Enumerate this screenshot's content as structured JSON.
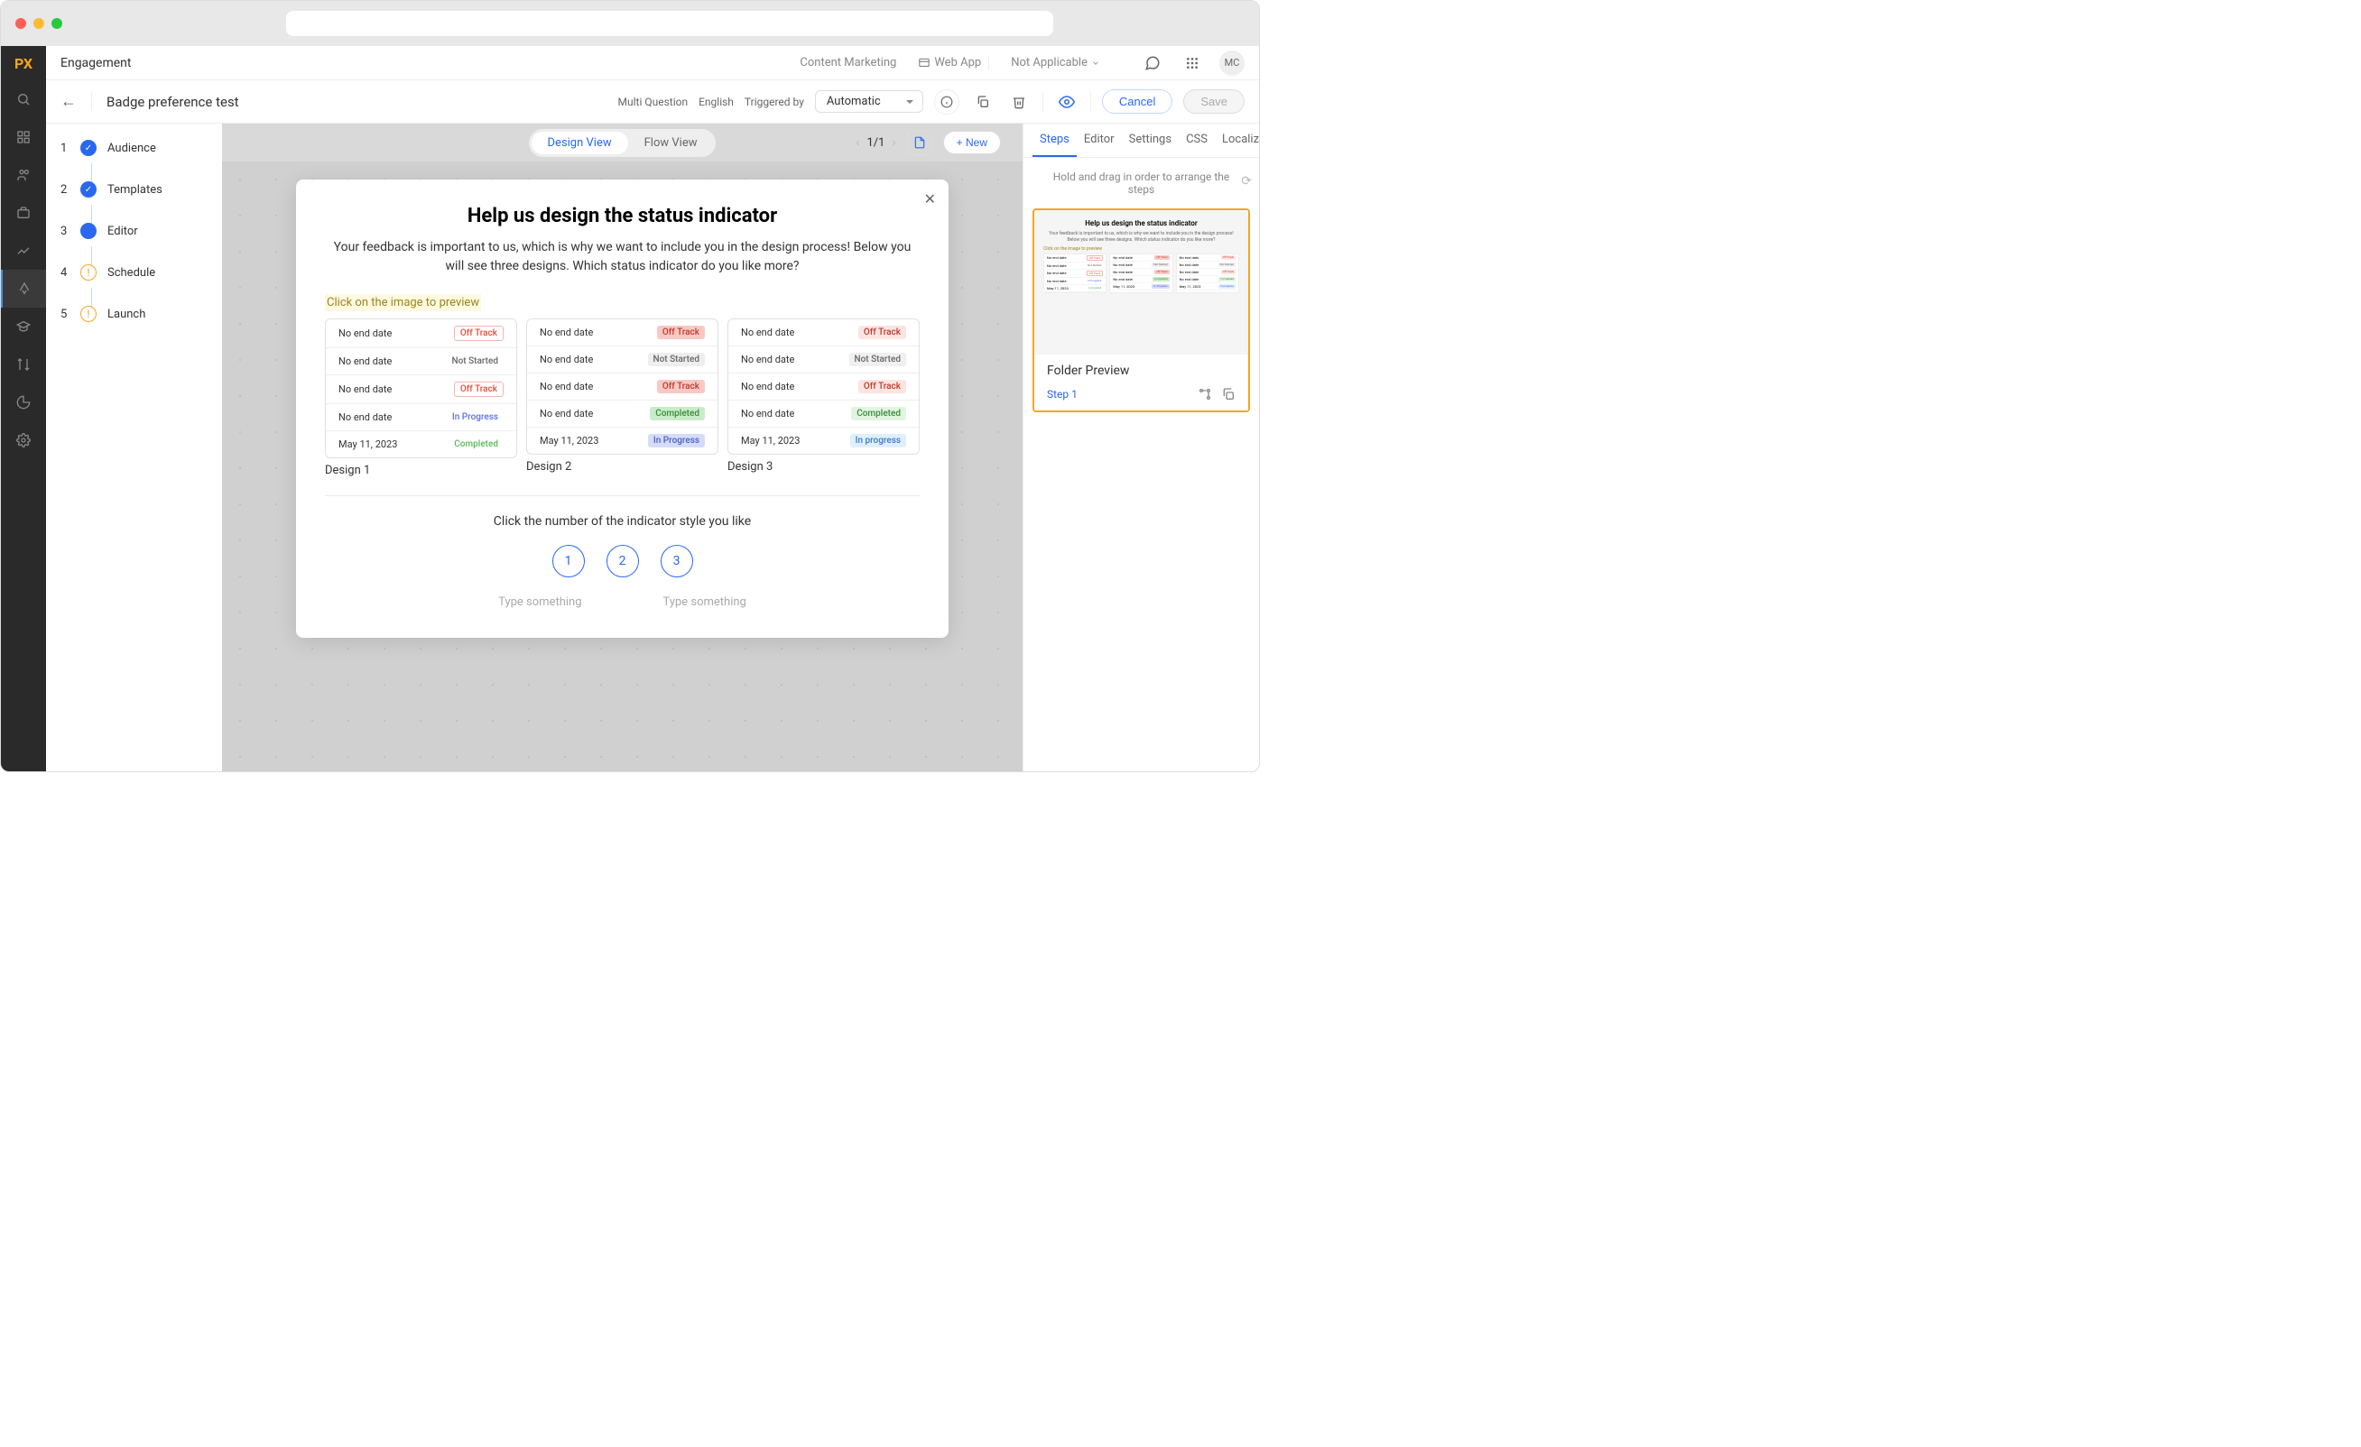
{
  "logo": "PX",
  "topbar": {
    "title": "Engagement",
    "tabs": [
      "Content Marketing",
      "Web App",
      "Not Applicable"
    ],
    "avatar": "MC"
  },
  "subbar": {
    "page_title": "Badge preference test",
    "type_label": "Multi Question",
    "lang_label": "English",
    "trigger_label": "Triggered by",
    "trigger_value": "Automatic",
    "cancel": "Cancel",
    "save": "Save"
  },
  "steps": [
    {
      "num": "1",
      "label": "Audience",
      "state": "check"
    },
    {
      "num": "2",
      "label": "Templates",
      "state": "check"
    },
    {
      "num": "3",
      "label": "Editor",
      "state": "current"
    },
    {
      "num": "4",
      "label": "Schedule",
      "state": "pending"
    },
    {
      "num": "5",
      "label": "Launch",
      "state": "pending"
    }
  ],
  "canvas": {
    "view_design": "Design View",
    "view_flow": "Flow View",
    "page": "1/1",
    "new_btn": "+ New"
  },
  "modal": {
    "title": "Help us design the status indicator",
    "desc": "Your feedback is important to us, which is why we want to include you in the design process! Below you will see three designs. Which status indicator do you like more?",
    "hint": "Click on the image to preview",
    "prompt": "Click the number of the indicator style you like",
    "choices": [
      "1",
      "2",
      "3"
    ],
    "placeholder1": "Type something",
    "placeholder2": "Type something",
    "designs": [
      {
        "label": "Design 1",
        "style": "1",
        "rows": [
          {
            "date": "No end date",
            "status": "Off Track",
            "cls": "b1-off"
          },
          {
            "date": "No end date",
            "status": "Not Started",
            "cls": "b1-not"
          },
          {
            "date": "No end date",
            "status": "Off Track",
            "cls": "b1-off"
          },
          {
            "date": "No end date",
            "status": "In Progress",
            "cls": "b1-prog"
          },
          {
            "date": "May 11, 2023",
            "status": "Completed",
            "cls": "b1-done"
          }
        ]
      },
      {
        "label": "Design 2",
        "style": "2",
        "rows": [
          {
            "date": "No end date",
            "status": "Off Track",
            "cls": "b2-off"
          },
          {
            "date": "No end date",
            "status": "Not Started",
            "cls": "b2-not"
          },
          {
            "date": "No end date",
            "status": "Off Track",
            "cls": "b2-off"
          },
          {
            "date": "No end date",
            "status": "Completed",
            "cls": "b2-done"
          },
          {
            "date": "May 11, 2023",
            "status": "In Progress",
            "cls": "b2-prog"
          }
        ]
      },
      {
        "label": "Design 3",
        "style": "3",
        "rows": [
          {
            "date": "No end date",
            "status": "Off Track",
            "cls": "b3-off"
          },
          {
            "date": "No end date",
            "status": "Not Started",
            "cls": "b3-not"
          },
          {
            "date": "No end date",
            "status": "Off Track",
            "cls": "b3-off"
          },
          {
            "date": "No end date",
            "status": "Completed",
            "cls": "b3-done"
          },
          {
            "date": "May 11, 2023",
            "status": "In progress",
            "cls": "b3-prog"
          }
        ]
      }
    ]
  },
  "panel": {
    "tabs": [
      "Steps",
      "Editor",
      "Settings",
      "CSS",
      "Localiza"
    ],
    "hint": "Hold and drag in order to arrange the steps",
    "step_name": "Folder Preview",
    "step_id": "Step 1"
  }
}
